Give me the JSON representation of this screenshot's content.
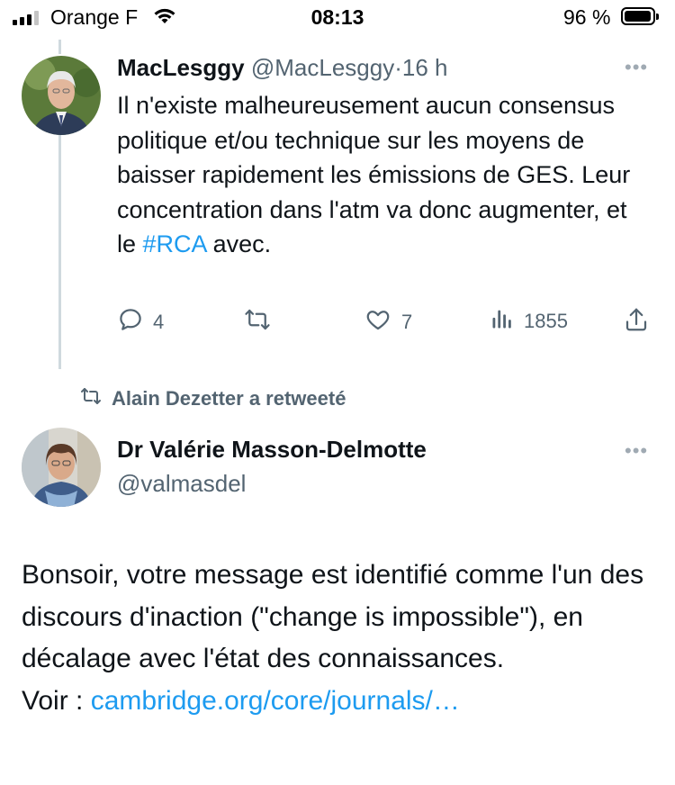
{
  "status_bar": {
    "carrier": "Orange F",
    "time": "08:13",
    "battery": "96 %"
  },
  "tweet1": {
    "name": "MacLesggy",
    "handle": "@MacLesggy",
    "separator": "·",
    "time": "16 h",
    "more": "•••",
    "body_before": "Il n'existe malheureusement aucun consensus politique et/ou technique sur les moyens de baisser rapidement les émissions de GES. Leur concentration dans l'atm va donc augmenter, et le ",
    "hashtag": "#RCA",
    "body_after": " avec.",
    "replies": "4",
    "likes": "7",
    "views": "1855"
  },
  "retweet_label": "Alain Dezetter a retweeté",
  "tweet2": {
    "name": "Dr Valérie Masson-Delmotte",
    "handle": "@valmasdel",
    "more": "•••",
    "body": "Bonsoir, votre message est identifié comme l'un des discours d'inaction (\"change is impossible\"), en décalage avec l'état des connaissances.",
    "link_prefix": "Voir : ",
    "link": "cambridge.org/core/journals/…"
  },
  "colors": {
    "link": "#1d9bf0",
    "secondary_text": "#536471",
    "thread_line": "#cfd9de"
  }
}
